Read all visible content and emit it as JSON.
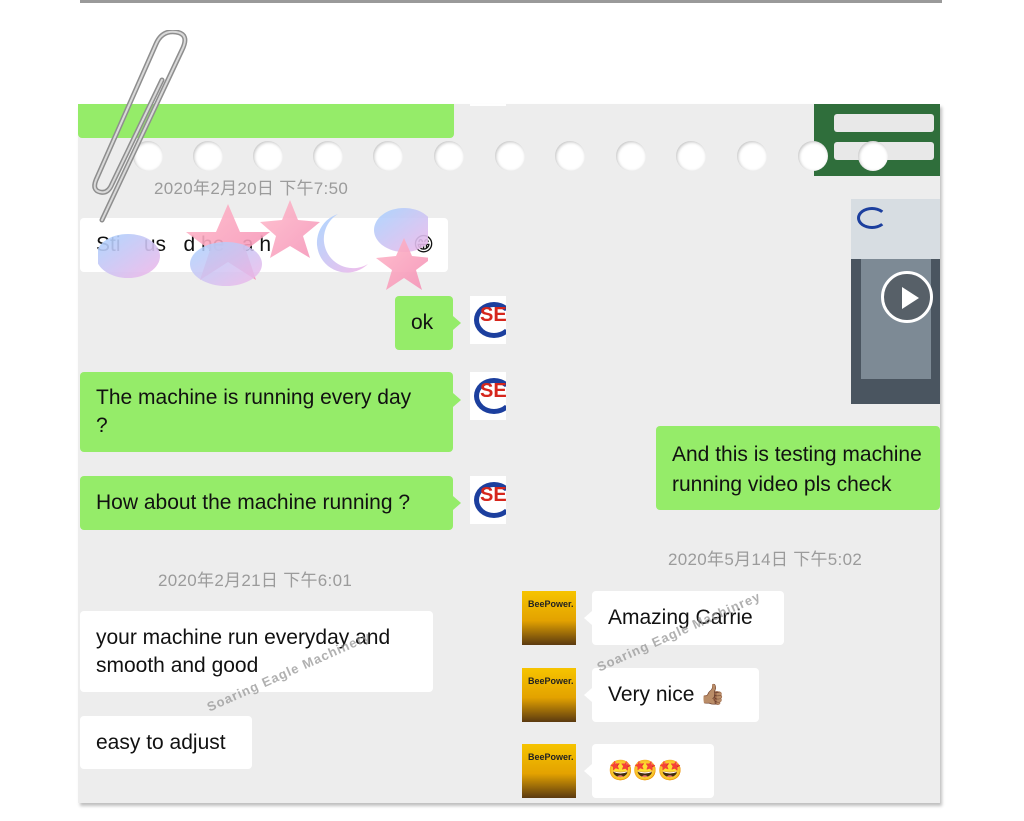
{
  "timestamps": {
    "t1": "2020年2月20日 下午7:50",
    "t2": "2020年2月21日 下午6:01",
    "t3": "2020年5月14日 下午5:02"
  },
  "messages": {
    "partial_top": "Sti    us   d he   a h",
    "ok": "ok",
    "running_every_day_l1": "The machine is running every day",
    "running_every_day_l2": "?",
    "how_about": "How about the machine running ?",
    "reply_l1": "your machine run everyday and",
    "reply_l2": "smooth and good",
    "easy": "easy to adjust",
    "testing_l1": "And this is testing machine",
    "testing_l2": "running video pls check",
    "amazing": "Amazing Carrie",
    "very_nice": "Very nice",
    "emojis": "🤩🤩🤩"
  },
  "avatars": {
    "sem_label": "SEI",
    "bee_label": "BeePower."
  },
  "watermarks": {
    "left": "Soaring Eagle Machinery",
    "right": "Soaring Eagle Machinrey"
  },
  "icons": {
    "grin_emoji": "😁",
    "thumbs_up": "👍🏽",
    "play": "play-icon",
    "paperclip": "paperclip-icon"
  },
  "colors": {
    "green_bubble": "#95ec69",
    "chat_bg": "#ededed",
    "sem_blue": "#1c3f9e",
    "sem_red": "#d6261c"
  }
}
